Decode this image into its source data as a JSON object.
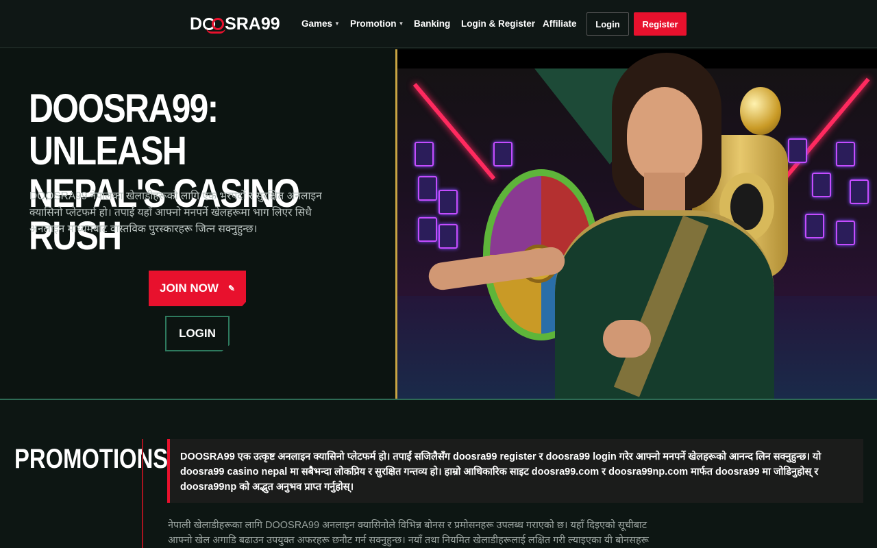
{
  "header": {
    "logo_text": "DOOSRA99",
    "nav": [
      {
        "label": "Games",
        "has_caret": true
      },
      {
        "label": "Promotion",
        "has_caret": true
      },
      {
        "label": "Banking",
        "has_caret": false
      },
      {
        "label": "Login & Register",
        "has_caret": false
      },
      {
        "label": "Affiliate",
        "has_caret": false
      }
    ],
    "login_label": "Login",
    "register_label": "Register"
  },
  "hero": {
    "title_line1": "DOOSRA99: UNLEASH",
    "title_line2": "NEPAL'S CASINO RUSH",
    "description": "DOOSRA99 नेपालका खेलाडीहरूको लागि एक भरपर्दो र सुरक्षित अनलाइन क्यासिनो प्लेटफर्म हो। तपाईं यहाँ आफ्नो मनपर्ने खेलहरूमा भाग लिएर सिधै अनलाइन माध्यमबाट वास्तविक पुरस्कारहरू जित्न सक्नुहुन्छ।",
    "join_label": "JOIN NOW",
    "login_label": "LOGIN"
  },
  "promotions": {
    "title": "PROMOTIONS",
    "highlight": "DOOSRA99 एक उत्कृष्ट अनलाइन क्यासिनो प्लेटफर्म हो। तपाईं सजिलैसँग doosra99 register र doosra99 login गरेर आफ्नो मनपर्ने खेलहरूको आनन्द लिन सक्नुहुन्छ। यो doosra99 casino nepal मा सबैभन्दा लोकप्रिय र सुरक्षित गन्तव्य हो। हाम्रो आधिकारिक साइट doosra99.com र doosra99np.com मार्फत doosra99 मा जोडिनुहोस् र doosra99np को अद्भुत अनुभव प्राप्त गर्नुहोस्।",
    "description": "नेपाली खेलाडीहरूका लागि DOOSRA99 अनलाइन क्यासिनोले विभिन्न बोनस र प्रमोसनहरू उपलब्ध गराएको छ। यहाँ दिइएको सूचीबाट आफ्नो खेल अगाडि बढाउन उपयुक्त अफरहरू छनौट गर्न सक्नुहुन्छ। नयाँ तथा नियमित खेलाडीहरूलाई लक्षित गरी ल्याइएका यी बोनसहरू दाबी गर्न तल"
  },
  "colors": {
    "accent_red": "#e8112d",
    "accent_green": "#2e7a5e",
    "gold": "#c9a543",
    "background": "#0d1613"
  },
  "icons": {
    "join_icon": "pencil-icon",
    "nav_caret": "chevron-down-icon"
  }
}
